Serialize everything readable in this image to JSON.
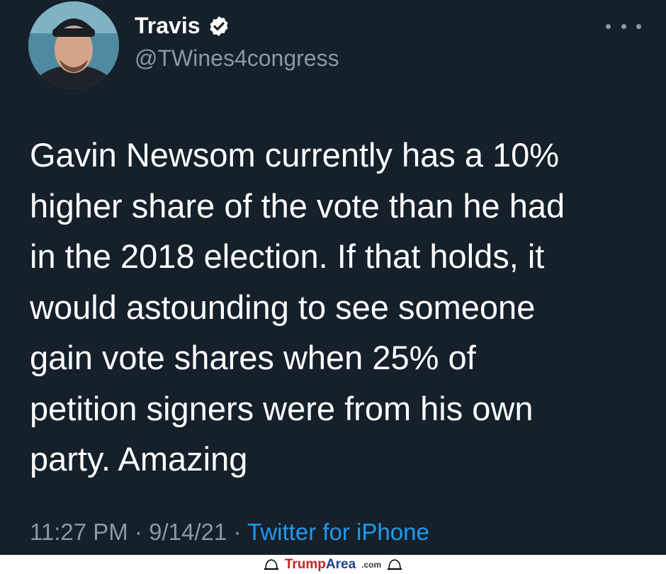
{
  "tweet": {
    "name": "Travis",
    "handle": "@TWines4congress",
    "text": "Gavin Newsom currently has a 10%\nhigher share of the vote than he had\nin the 2018 election.  If that holds, it\nwould astounding to see someone\ngain vote shares when 25% of\npetition signers were from his own\nparty.  Amazing",
    "time": "11:27 PM",
    "date": "9/14/21",
    "separator": "·",
    "source": "Twitter for iPhone",
    "verified_icon": "verified-badge-icon",
    "more_icon": "more-options-icon"
  },
  "footer": {
    "brand_trump": "Trump",
    "brand_area": "Area",
    "brand_suffix": ".com"
  },
  "colors": {
    "background": "#15202b",
    "text": "#ffffff",
    "secondary": "#8b98a5",
    "link": "#1d9bf0"
  }
}
